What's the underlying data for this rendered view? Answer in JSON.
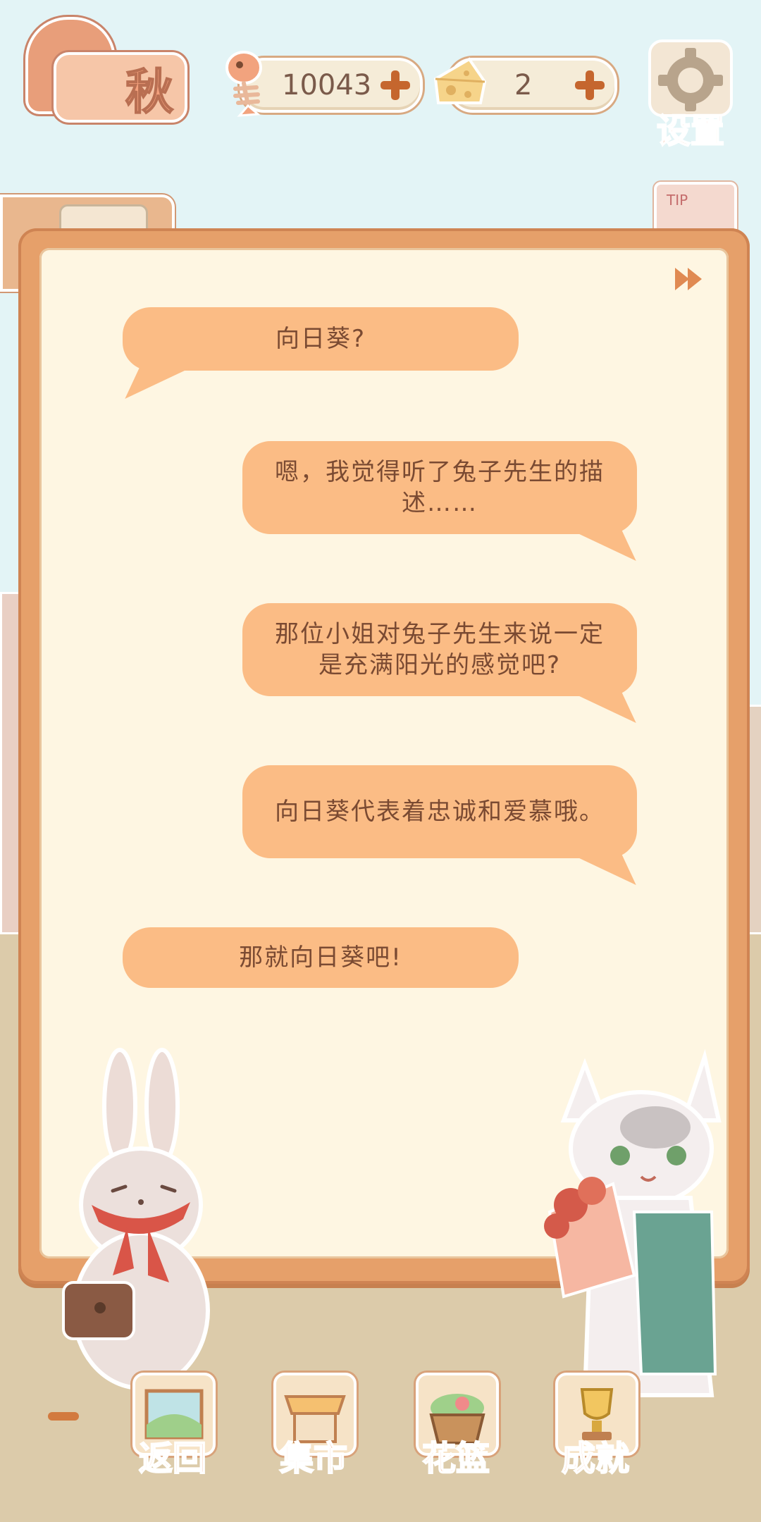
{
  "hud": {
    "season": "秋",
    "fish_count": "10043",
    "cheese_count": "2",
    "settings_label": "设置",
    "tip_tag": "TIP"
  },
  "dialog": [
    {
      "speaker": "rabbit",
      "text": "向日葵?"
    },
    {
      "speaker": "cat",
      "text": "嗯，我觉得听了兔子先生的描述……"
    },
    {
      "speaker": "cat",
      "text": "那位小姐对兔子先生来说一定是充满阳光的感觉吧?"
    },
    {
      "speaker": "cat",
      "text": "向日葵代表着忠诚和爱慕哦。"
    },
    {
      "speaker": "rabbit",
      "text": "那就向日葵吧!"
    }
  ],
  "nav": {
    "back": "返回",
    "market": "集市",
    "basket": "花篮",
    "achievement": "成就"
  },
  "colors": {
    "bubble": "#fbbc85",
    "board": "#e6a06a",
    "paper": "#fef6e2",
    "sky": "#e3f4f6",
    "ground": "#dccbaa"
  },
  "icons": [
    "fishbone-icon",
    "cheese-icon",
    "plus-icon",
    "gear-icon",
    "fast-forward-icon",
    "rabbit-character",
    "cat-character"
  ]
}
